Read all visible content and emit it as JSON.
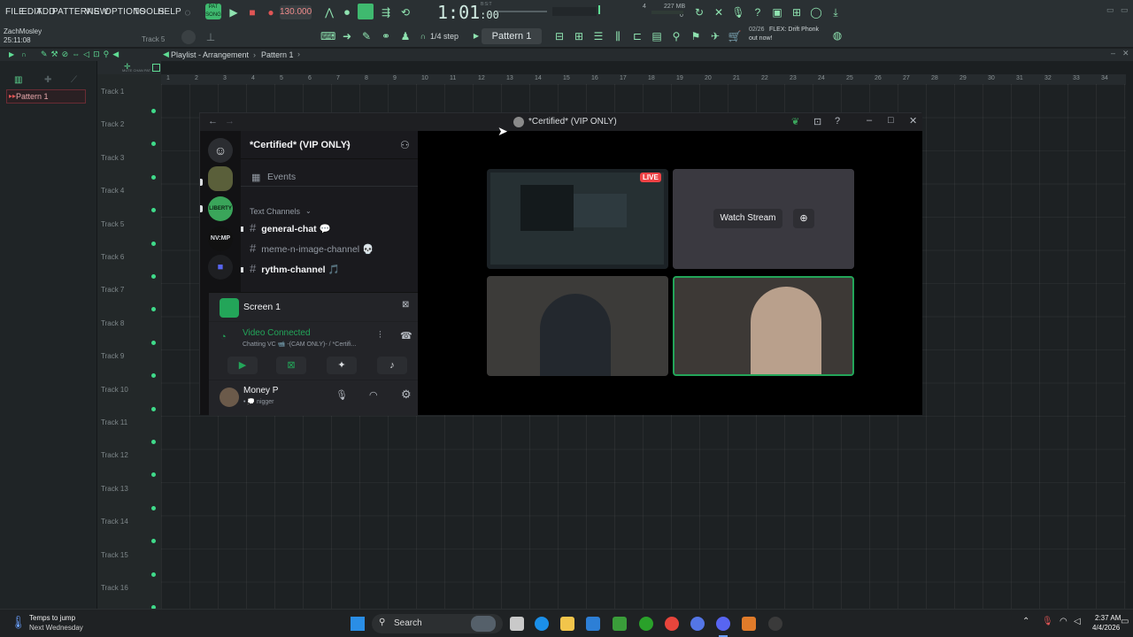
{
  "fl": {
    "menu": [
      "FILE",
      "EDIT",
      "ADD",
      "PATTERNS",
      "VIEW",
      "OPTIONS",
      "TOOLS",
      "HELP"
    ],
    "user": "ZachMosley",
    "clock": "25:11:08",
    "track_hint": "Track 5",
    "bpm": "130.000",
    "time": "1:01",
    "time_small": ":00",
    "bst": "B:S:T",
    "mem": "227 MB",
    "mem2": "0",
    "cpu": "4",
    "step": "1/4 step",
    "pattern": "Pattern 1",
    "news_count": "02/26",
    "news_title": "FLEX: Drift Phonk",
    "news_sub": "out now!",
    "pat_label": "PAT",
    "song_label": "SONG",
    "playlist_title": "Playlist - Arrangement",
    "playlist_pattern": "Pattern 1",
    "pattern_item": "Pattern 1",
    "tracks": [
      "Track 1",
      "Track 2",
      "Track 3",
      "Track 4",
      "Track 5",
      "Track 6",
      "Track 7",
      "Track 8",
      "Track 9",
      "Track 10",
      "Track 11",
      "Track 12",
      "Track 13",
      "Track 14",
      "Track 15",
      "Track 16"
    ],
    "ruler": [
      "1",
      "2",
      "3",
      "4",
      "5",
      "6",
      "7",
      "8",
      "9",
      "10",
      "11",
      "12",
      "13",
      "14",
      "15",
      "16",
      "17",
      "18",
      "19",
      "20",
      "21",
      "22",
      "23",
      "24",
      "25",
      "26",
      "27",
      "28",
      "29",
      "30",
      "31",
      "32",
      "33",
      "34"
    ]
  },
  "discord": {
    "window_title": "*Certified* (VIP ONLY)",
    "server_name": "*Certified* (VIP ONLY)",
    "events": "Events",
    "text_channels": "Text Channels",
    "channels": [
      "general-chat 💬",
      "meme-n-image-channel 💀",
      "rythm-channel 🎵"
    ],
    "screen_label": "Screen 1",
    "voice_status": "Video Connected",
    "voice_sub": "Chatting VC 📹 -(CAM ONLY)- / *Certifi...",
    "user_name": "Money P",
    "user_status": "• 💭 nigger",
    "live_badge": "LIVE",
    "watch_stream": "Watch Stream",
    "nvmp": "NV:MP",
    "server3": "LIBERTY"
  },
  "taskbar": {
    "weather_title": "Temps to jump",
    "weather_sub": "Next Wednesday",
    "search": "Search",
    "time": "2:37 AM",
    "date": "4/4/2026"
  },
  "colors": {
    "accent": "#5fdc94",
    "discord_green": "#23a559",
    "live_red": "#ed4245"
  }
}
